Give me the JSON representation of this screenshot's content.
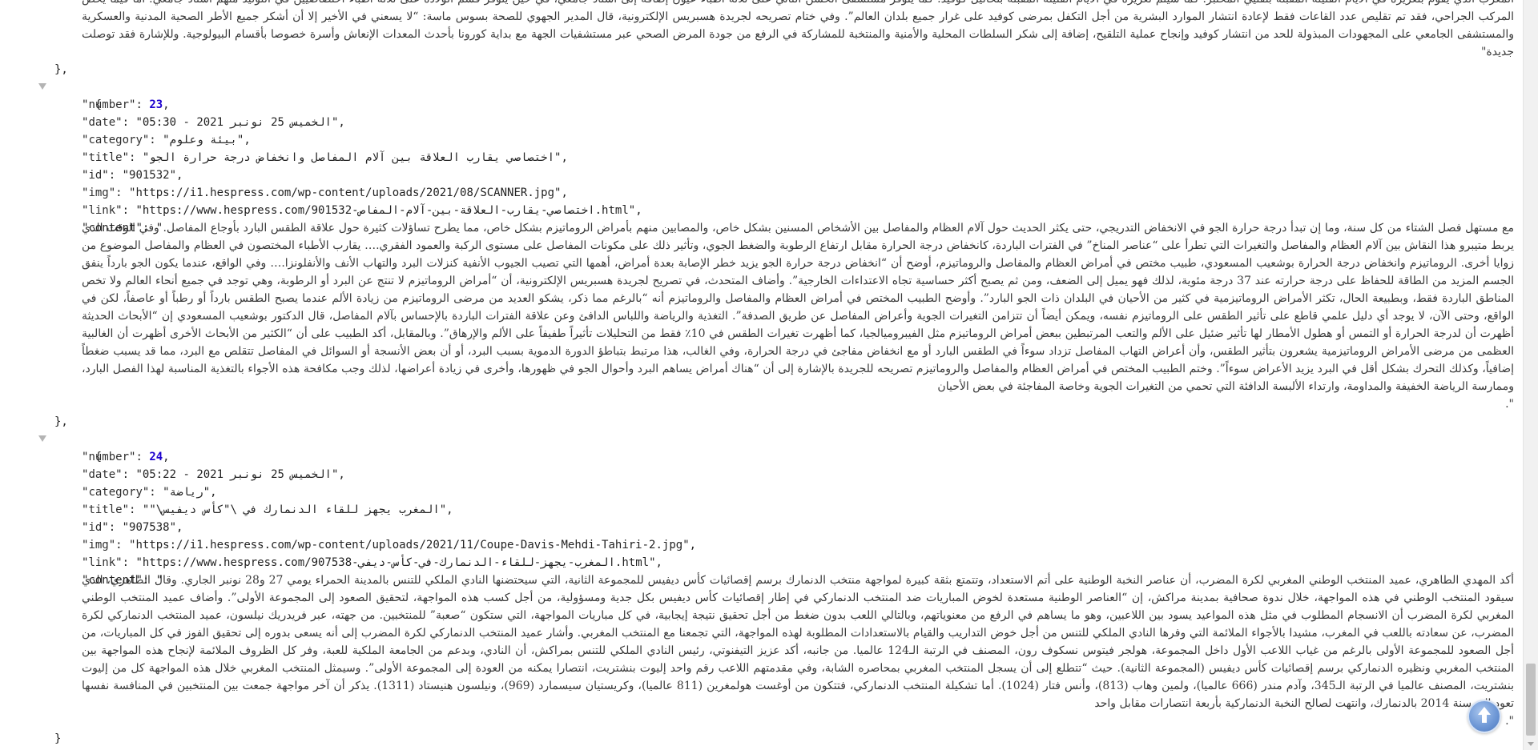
{
  "top_item": {
    "content_tail": "المغرب الذي يقوم بتعزيزه في الأيام القليلة المقبلة بتقنيي المختبر. كما سيتم تعزيزه في الأيام القليلة المقبلة بتحاليل كوفيد. كما يتوفر مستشفى الحسن الثاني على ثلاثة أطباء عيون إضافة إلى أستاذ جامعي، في حين يتوفر قسم الولادة على ثلاثة أطباء اختصاصيين في التوليد منهم أستاذ جامعي. أما فيما يخص المركب الجراحي، فقد تم تقليص عدد القاعات فقط لإعادة انتشار الموارد البشرية من أجل التكفل بمرضى كوفيد على غرار جميع بلدان العالم”. وفي ختام تصريحه لجريدة هسبريس الإلكترونية، قال المدير الجهوي للصحة بسوس ماسة: “لا يسعني في الأخير إلا أن أشكر جميع الأطر الصحية المدنية والعسكرية والمستشفى الجامعي على المجهودات المبذولة للحد من انتشار كوفيد وإنجاح عملية التلقيح، إضافة إلى شكر السلطات المحلية والأمنية والمنتخبة للمشاركة في الرفع من جودة المرض الصحي عبر مستشفيات الجهة مع بداية كورونا بأحدث المعدات الإنعاش وأسرة خصوصا بأقسام البيولوجية. وللإشارة فقد توصلت جديدة"
  },
  "items": [
    {
      "number": "23",
      "date": "الخميس 25 نونبر 2021 - 05:30",
      "category": "بيئة وعلوم",
      "title": "اختصاصي يقارب العلاقة بين آلام المفاصل وانخفاض درجة حرارة الجو",
      "id": "901532",
      "img": "https://i1.hespress.com/wp-content/uploads/2021/08/SCANNER.jpg",
      "link": "https://www.hespress.com/اختصاصي-يقارب-العلاقة-بين-آلام-المفاص-901532.html",
      "content": "مع مستهل فصل الشتاء من كل سنة، وما إن تبدأ درجة حرارة الجو في الانخفاض التدريجي، حتى يكثر الحديث حول آلام العظام والمفاصل بين الأشخاص المسنين بشكل خاص، والمصابين منهم بأمراض الروماتيزم بشكل خاص، مما يطرح تساؤلات كثيرة حول علاقة الطقس البارد بأوجاع المفاصل. وفي الوقت الذي يربط متيبرو هذا النقاش بين آلام العظام والمفاصل والتغيرات التي تطرأ على “عناصر المناخ” في الفترات الباردة، كانخفاض درجة الحرارة مقابل ارتفاع الرطوبة والضغط الجوي، وتأثير ذلك على مكونات المفاصل على مستوى الركبة والعمود الفقري.… يقارب الأطباء المختصون في العظام والمفاصل الموضوع من زوايا أخرى. الروماتيزم وانخفاض درجة الحرارة بوشعيب المسعودي، طبيب مختص في أمراض العظام والمفاصل والروماتيزم، أوضح أن “انخفاض درجة حرارة الجو يزيد خطر الإصابة بعدة أمراض، أهمها التي تصيب الجيوب الأنفية كنزلات البرد والتهاب الأنف والأنفلونزا.… وفي الواقع، عندما يكون الجو بارداً ينفق الجسم المزيد من الطاقة للحفاظ على درجة حرارته عند 37 درجة مئوية، لذلك فهو يميل إلى الضعف، ومن ثم يصبح أكثر حساسية تجاه الاعتداءات الخارجية”. وأضاف المتحدث، في تصريح لجريدة هسبريس الإلكترونية، أن “أمراض الروماتيزم لا تنتج عن البرد أو الرطوبة، وهي توجد في جميع أنحاء العالم ولا تخص المناطق الباردة فقط، وبطبيعة الحال، تكثر الأمراض الروماتيزمية في كثير من الأحيان في البلدان ذات الجو البارد”. وأوضح الطبيب المختص في أمراض العظام والمفاصل والروماتيزم أنه “بالرغم مما ذكر، يشكو العديد من مرضى الروماتيزم من زيادة الألم عندما يصبح الطقس بارداً أو رطباً أو عاصفاً، لكن في الواقع، وحتى الآن، لا يوجد أي دليل علمي قاطع على تأثير الطقس على الروماتيزم نفسه، ويمكن أيضاً أن تتزامن التغيرات الجوية وأعراض المفاصل عن طريق الصدفة”. التغذية والرياضة واللباس الدافئ وعن علاقة الفترات الباردة بالإحساس بآلام المفاصل، قال الدكتور بوشعيب المسعودي إن “الأبحاث الحديثة أظهرت أن لدرجة الحرارة أو التمس أو هطول الأمطار لها تأثير ضئيل على الألم والتعب المرتبطين ببعض أمراض الروماتيزم مثل الفيبروميالجيا، كما أظهرت تغيرات الطقس في 10٪ فقط من التحليلات تأثيراً طفيفاً على الألم والإرهاق”. وبالمقابل، أكد الطبيب على أن “الكثير من الأبحاث الأخرى أظهرت أن الغالبية العظمى من مرضى الأمراض الروماتيزمية يشعرون بتأثير الطقس، وأن أعراض التهاب المفاصل تزداد سوءاً في الطقس البارد أو مع انخفاض مفاجئ في درجة الحرارة، وفي الغالب، هذا مرتبط بتباطؤ الدورة الدموية بسبب البرد، أو أن بعض الأنسجة أو السوائل في المفاصل تتقلص مع البرد، مما قد يسبب ضغطاً إضافياً، وكذلك التحرك بشكل أقل في البرد يزيد الأعراض سوءاً”. وختم الطبيب المختص في أمراض العظام والمفاصل والروماتيزم تصريحه للجريدة بالإشارة إلى أن “هناك أمراض يساهم البرد وأحوال الجو في ظهورها، وأخرى في زيادة أعراضها، لذلك وجب مكافحة هذه الأجواء بالتغذية المناسبة لهذا الفصل البارد، وممارسة الرياضة الخفيفة والمداومة، وارتداء الألبسة الدافئة التي تحمي من التغيرات الجوية وخاصة المفاجئة في بعض الأحيان"
    },
    {
      "number": "24",
      "date": "الخميس 25 نونبر 2021 - 05:22",
      "category": "رياضة",
      "title": "المغرب يجهز للقاء الدنمارك في \\\"كأس ديفيس\\\"",
      "id": "907538",
      "img": "https://i1.hespress.com/wp-content/uploads/2021/11/Coupe-Davis-Mehdi-Tahiri-2.jpg",
      "link": "https://www.hespress.com/المغرب-يجهز-للقاء-الدنمارك-في-كأس-ديفي-907538.html",
      "content": "أكد المهدي الطاهري، عميد المنتخب الوطني المغربي لكرة المضرب، أن عناصر النخبة الوطنية على أتم الاستعداد، وتتمتع بثقة كبيرة لمواجهة منتخب الدنمارك برسم إقصائيات كأس ديفيس للمجموعة الثانية، التي سيحتضنها النادي الملكي للتنس بالمدينة الحمراء يومي 27 و28 نونبر الجاري. وقال الطاهري، الذي سيقود المنتخب الوطني في هذه المواجهة، خلال ندوة صحافية بمدينة مراكش، إن “العناصر الوطنية مستعدة لخوض المباريات ضد المنتخب الدنماركي في إطار إقصائيات كأس ديفيس بكل جدية ومسؤولية، من أجل كسب هذه المواجهة، لتحقيق الصعود إلى المجموعة الأولى”. وأضاف عميد المنتخب الوطني المغربي لكرة المضرب أن الانسجام المطلوب في مثل هذه المواعيد يسود بين اللاعبين، وهو ما يساهم في الرفع من معنوياتهم، وبالتالي اللعب بدون ضغط من أجل تحقيق نتيجة إيجابية، في كل مباريات المواجهة، التي ستكون “صعبة” للمنتخبين. من جهته، عبر فريدريك نيلسون، عميد المنتخب الدنماركي لكرة المضرب، عن سعادته باللعب في المغرب، مشيدا بالأجواء الملائمة التي وفرها النادي الملكي للتنس من أجل خوض التداريب والقيام بالاستعدادات المطلوبة لهذه المواجهة، التي تجمعنا مع المنتخب المغربي. وأشار عميد المنتخب الدنماركي لكرة المضرب إلى أنه يسعى بدوره إلى تحقيق الفوز في كل المباريات، من أجل الصعود للمجموعة الأولى بالرغم من غياب اللاعب الأول داخل المجموعة، هولجر فيتوس نسكوف رون، المصنف في الرتبة الـ124 عالميا. من جانبه، أكد عزيز التيفنوتي، رئيس النادي الملكي للتنس بمراكش، أن النادي، وبدعم من الجامعة الملكية للعبة، وفر كل الظروف الملائمة لإنجاح هذه المواجهة بين المنتخب المغربي ونظيره الدنماركي برسم إقصائيات كأس ديفيس (المجموعة الثانية). حيث “تتطلع إلى أن يسجل المنتخب المغربي بمحاصره الشابة، وفي مقدمتهم اللاعب رقم واحد إليوت بنشتريت، انتصارا يمكنه من العودة إلى المجموعة الأولى”. وسيمثل المنتخب المغربي خلال هذه المواجهة كل من إليوت بنشتريت، المصنف عالميا في الرتبة الـ345، وآدم مندر (666 عالميا)، ولمين وهاب (813)، وأنس فتار (1024). أما تشكيلة المنتخب الدنماركي، فتتكون من أوغست هولمغرين (811 عالميا)، وكريستيان سيسمارد (969)، ونيلسون هنيستاد (1311). يذكر أن آخر مواجهة جمعت بين المنتخبين في المنافسة نفسها تعود إلى سنة 2014 بالدنمارك، وانتهت لصالح النخبة الدنماركية بأربعة انتصارات مقابل واحد"
    }
  ],
  "keys": {
    "number": "number",
    "date": "date",
    "category": "category",
    "title": "title",
    "id": "id",
    "img": "img",
    "link": "link",
    "content": "content"
  },
  "punctuation": {
    "open_brace": "{",
    "close_brace_comma": "},",
    "close_brace": "}",
    "close_bracket": "]"
  },
  "icons": {
    "fold_toggle": "caret-down-icon",
    "scroll_top": "arrow-up-icon"
  }
}
